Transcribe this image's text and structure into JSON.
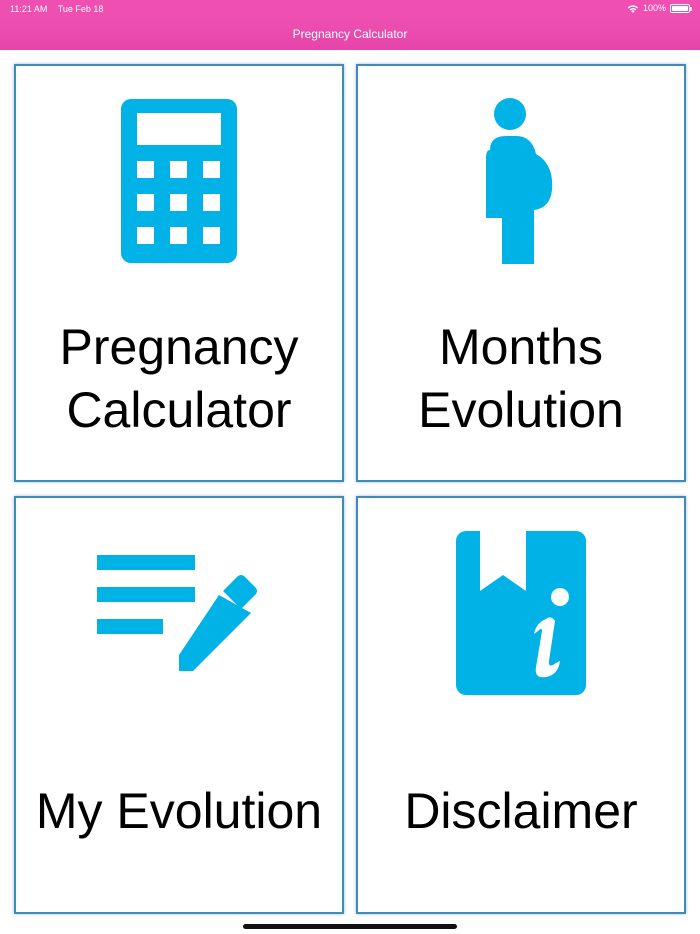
{
  "status_bar": {
    "time": "11:21 AM",
    "date": "Tue Feb 18",
    "battery": "100%",
    "wifi_icon": "wifi-icon",
    "battery_icon": "battery-icon"
  },
  "nav": {
    "title": "Pregnancy Calculator"
  },
  "colors": {
    "accent_pink": "#e94aad",
    "icon_blue": "#00b2e6",
    "tile_border": "#3d8dbb"
  },
  "tiles": [
    {
      "line1": "Pregnancy",
      "line2": "Calculator",
      "icon": "calculator-icon"
    },
    {
      "line1": "Months",
      "line2": "Evolution",
      "icon": "pregnant-woman-icon"
    },
    {
      "line1": "My Evolution",
      "icon": "edit-notes-icon"
    },
    {
      "line1": "Disclaimer",
      "icon": "info-book-icon"
    }
  ]
}
